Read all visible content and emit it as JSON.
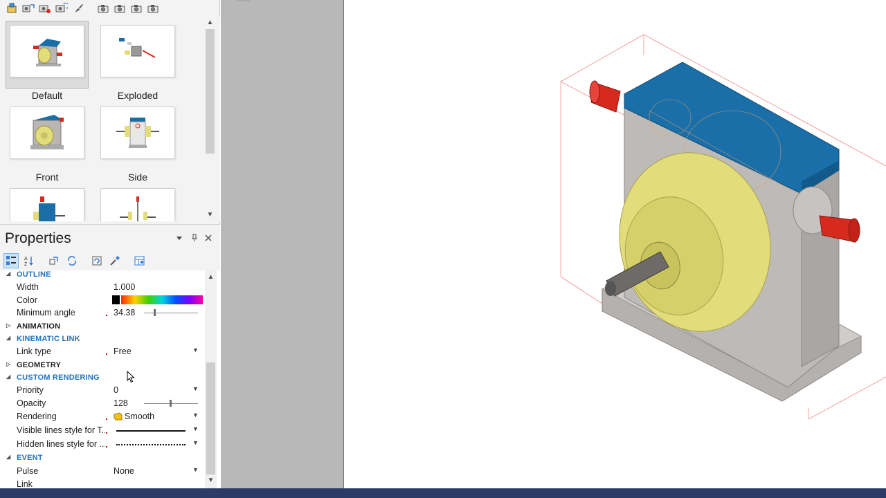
{
  "views": {
    "toolbar_icons": [
      "new-view-icon",
      "update-view-icon",
      "capture-view-icon",
      "refresh-views-icon",
      "brush-icon",
      "camera-1-icon",
      "camera-2-icon",
      "camera-3-icon",
      "camera-4-icon"
    ],
    "items": [
      {
        "label": "Default",
        "selected": true
      },
      {
        "label": "Exploded",
        "selected": false
      },
      {
        "label": "Front",
        "selected": false
      },
      {
        "label": "Side",
        "selected": false
      },
      {
        "label": "",
        "selected": false
      },
      {
        "label": "",
        "selected": false
      }
    ]
  },
  "properties": {
    "title": "Properties",
    "toolbar_icons": [
      "categorized-icon",
      "alphabetical-icon",
      "link-icon",
      "sync-icon",
      "rotate-icon",
      "eyedropper-icon",
      "add-table-icon"
    ],
    "rows": {
      "outline_header": "OUTLINE",
      "width_name": "Width",
      "width_value": "1.000",
      "color_name": "Color",
      "min_angle_name": "Minimum angle",
      "min_angle_value": "34.38",
      "animation_header": "ANIMATION",
      "kinematic_header": "KINEMATIC LINK",
      "link_type_name": "Link type",
      "link_type_value": "Free",
      "geometry_header": "GEOMETRY",
      "custom_rendering_header": "CUSTOM RENDERING",
      "priority_name": "Priority",
      "priority_value": "0",
      "opacity_name": "Opacity",
      "opacity_value": "128",
      "rendering_name": "Rendering",
      "rendering_value": "Smooth",
      "visible_lines_name": "Visible lines style for T...",
      "hidden_lines_name": "Hidden lines style for ...",
      "event_header": "EVENT",
      "pulse_name": "Pulse",
      "pulse_value": "None",
      "link_name": "Link"
    },
    "min_angle_fraction": 0.2,
    "opacity_fraction": 0.5
  },
  "colors": {
    "accent_blue": "#1e73be",
    "status_bar": "#2b3a67",
    "housing_blue": "#1a6fa8",
    "flange_yellow": "#e2dc7a",
    "shaft_red": "#d62a1e",
    "body_gray": "#b9b6b3"
  }
}
